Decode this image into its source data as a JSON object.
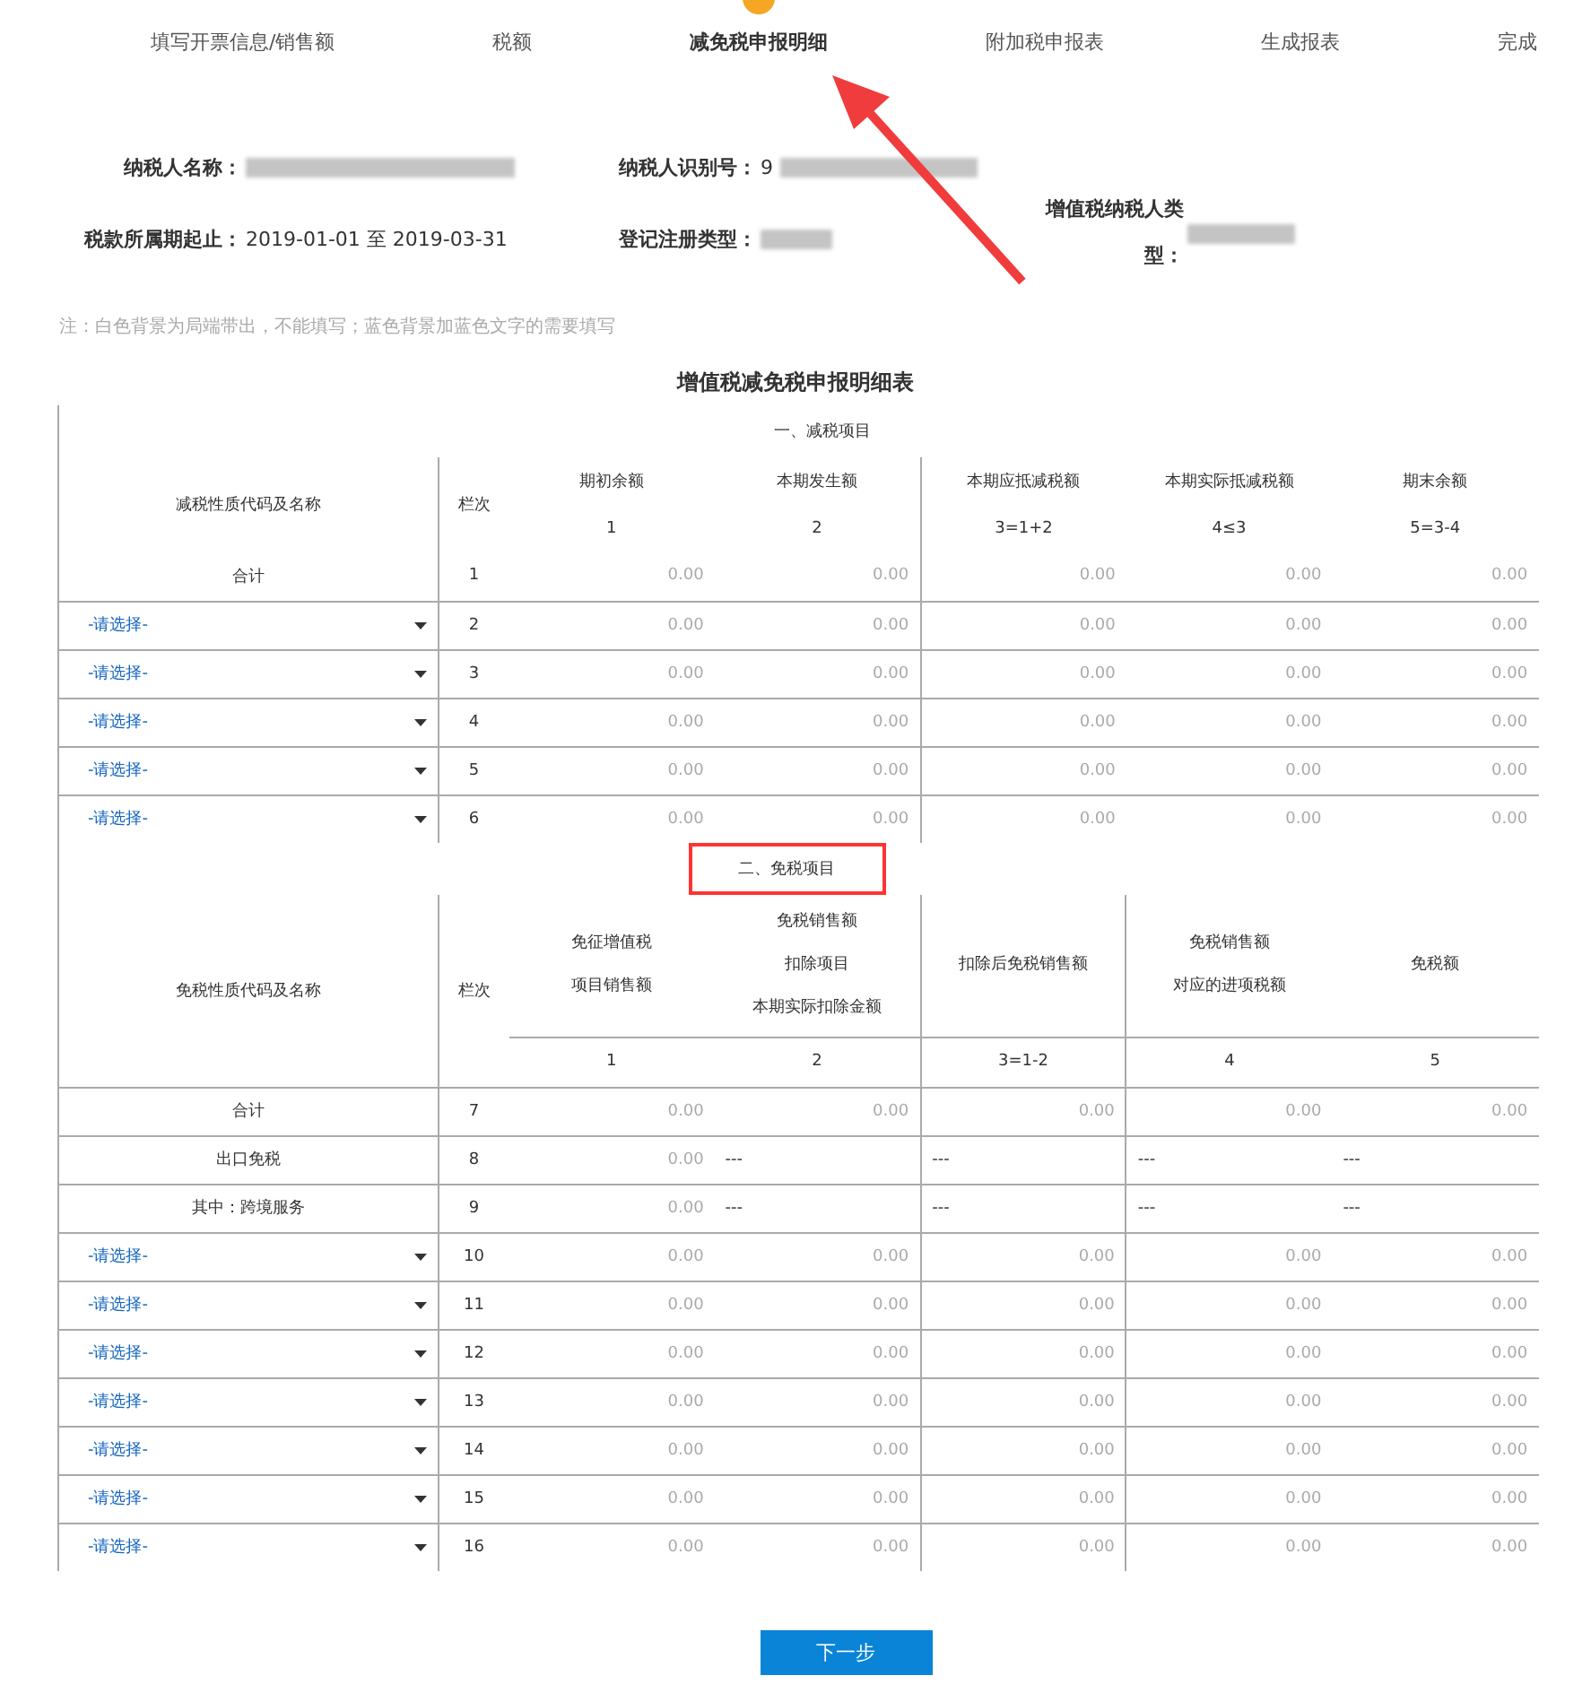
{
  "steps": [
    {
      "label": "填写开票信息/销售额",
      "current": false
    },
    {
      "label": "税额",
      "current": false
    },
    {
      "label": "减免税申报明细",
      "current": true,
      "pointed": true
    },
    {
      "label": "附加税申报表",
      "current": false
    },
    {
      "label": "生成报表",
      "current": false
    },
    {
      "label": "完成",
      "current": false
    }
  ],
  "taxpayer_info": [
    {
      "label": "纳税人名称：",
      "redacted": true
    },
    {
      "label": "纳税人识别号：",
      "value": "9",
      "redacted": true
    },
    {
      "label": "税款所属期起止：",
      "value": "2019-01-01 至 2019-03-31",
      "redacted": false
    },
    {
      "label": "登记注册类型：",
      "redacted": true
    },
    {
      "label": "增值税纳税人类型：",
      "redacted": true
    }
  ],
  "note": "注：白色背景为局端带出，不能填写；蓝色背景加蓝色文字的需要填写",
  "table_title": "增值税减免税申报明细表",
  "sections": [
    {
      "title": "一、减税项目",
      "highlighted": false,
      "name_header": "减税性质代码及名称",
      "line_header": "栏次",
      "columns": [
        {
          "lines": [
            "期初余额"
          ],
          "number": "1"
        },
        {
          "lines": [
            "本期发生额"
          ],
          "number": "2"
        },
        {
          "lines": [
            "本期应抵减税额"
          ],
          "number": "3=1+2"
        },
        {
          "lines": [
            "本期实际抵减税额"
          ],
          "number": "4≤3"
        },
        {
          "lines": [
            "期末余额"
          ],
          "number": "5=3-4"
        }
      ],
      "rows": [
        {
          "kind": "total",
          "name": "合计",
          "line": "1",
          "values": [
            "0.00",
            "0.00",
            "0.00",
            "0.00",
            "0.00"
          ]
        },
        {
          "kind": "select",
          "name": "-请选择-",
          "line": "2",
          "values": [
            "0.00",
            "0.00",
            "0.00",
            "0.00",
            "0.00"
          ]
        },
        {
          "kind": "select",
          "name": "-请选择-",
          "line": "3",
          "values": [
            "0.00",
            "0.00",
            "0.00",
            "0.00",
            "0.00"
          ]
        },
        {
          "kind": "select",
          "name": "-请选择-",
          "line": "4",
          "values": [
            "0.00",
            "0.00",
            "0.00",
            "0.00",
            "0.00"
          ]
        },
        {
          "kind": "select",
          "name": "-请选择-",
          "line": "5",
          "values": [
            "0.00",
            "0.00",
            "0.00",
            "0.00",
            "0.00"
          ]
        },
        {
          "kind": "select",
          "name": "-请选择-",
          "line": "6",
          "values": [
            "0.00",
            "0.00",
            "0.00",
            "0.00",
            "0.00"
          ]
        }
      ]
    },
    {
      "title": "二、免税项目",
      "highlighted": true,
      "name_header": "免税性质代码及名称",
      "line_header": "栏次",
      "columns": [
        {
          "lines": [
            "免征增值税",
            "项目销售额"
          ],
          "number": "1"
        },
        {
          "lines": [
            "免税销售额",
            "扣除项目",
            "本期实际扣除金额"
          ],
          "number": "2"
        },
        {
          "lines": [
            "扣除后免税销售额"
          ],
          "number": "3=1-2"
        },
        {
          "lines": [
            "免税销售额",
            "对应的进项税额"
          ],
          "number": "4"
        },
        {
          "lines": [
            "免税额"
          ],
          "number": "5"
        }
      ],
      "rows": [
        {
          "kind": "total",
          "name": "合计",
          "line": "7",
          "values": [
            "0.00",
            "0.00",
            "0.00",
            "0.00",
            "0.00"
          ]
        },
        {
          "kind": "fixed",
          "name": "出口免税",
          "line": "8",
          "values": [
            "0.00",
            "---",
            "---",
            "---",
            "---"
          ]
        },
        {
          "kind": "fixed",
          "name": "其中：跨境服务",
          "line": "9",
          "values": [
            "0.00",
            "---",
            "---",
            "---",
            "---"
          ]
        },
        {
          "kind": "select",
          "name": "-请选择-",
          "line": "10",
          "values": [
            "0.00",
            "0.00",
            "0.00",
            "0.00",
            "0.00"
          ]
        },
        {
          "kind": "select",
          "name": "-请选择-",
          "line": "11",
          "values": [
            "0.00",
            "0.00",
            "0.00",
            "0.00",
            "0.00"
          ]
        },
        {
          "kind": "select",
          "name": "-请选择-",
          "line": "12",
          "values": [
            "0.00",
            "0.00",
            "0.00",
            "0.00",
            "0.00"
          ]
        },
        {
          "kind": "select",
          "name": "-请选择-",
          "line": "13",
          "values": [
            "0.00",
            "0.00",
            "0.00",
            "0.00",
            "0.00"
          ]
        },
        {
          "kind": "select",
          "name": "-请选择-",
          "line": "14",
          "values": [
            "0.00",
            "0.00",
            "0.00",
            "0.00",
            "0.00"
          ]
        },
        {
          "kind": "select",
          "name": "-请选择-",
          "line": "15",
          "values": [
            "0.00",
            "0.00",
            "0.00",
            "0.00",
            "0.00"
          ]
        },
        {
          "kind": "select",
          "name": "-请选择-",
          "line": "16",
          "values": [
            "0.00",
            "0.00",
            "0.00",
            "0.00",
            "0.00"
          ]
        }
      ]
    }
  ],
  "next_button": "下一步"
}
